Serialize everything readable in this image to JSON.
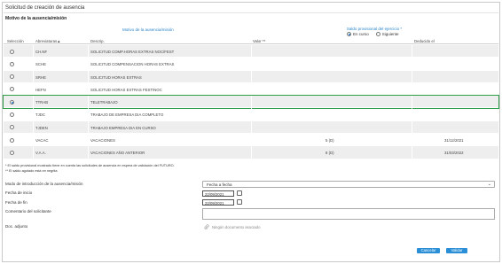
{
  "window_title": "Solicitud de creación de ausencia",
  "section_title": "Motivo de la ausencia/misión",
  "group_headers": {
    "motivo": "Motivo de la ausencia/misión",
    "saldo": "Saldo provisional del ejercicio *",
    "saldo_opt_1": "En curso",
    "saldo_opt_2": "Siguiente"
  },
  "columns": [
    "Selección",
    "Abreviaturas▲",
    "Descrip.",
    "Valor **",
    "Deducido el"
  ],
  "rows": [
    {
      "abbr": "CH.NF",
      "desc": "SOLICITUD COMP.HORAS EXTRAS NOC/FEST",
      "valor": "",
      "fecha": ""
    },
    {
      "abbr": "SCHE",
      "desc": "SOLICITUD COMPENSACION HORAS EXTRAS",
      "valor": "",
      "fecha": ""
    },
    {
      "abbr": "SRHE",
      "desc": "SOLICITUD HORAS EXTRAS",
      "valor": "",
      "fecha": ""
    },
    {
      "abbr": "HEFN",
      "desc": "SOLICITUD HORAS EXTRAS FEST/NOC",
      "valor": "",
      "fecha": ""
    },
    {
      "abbr": "TTRAB",
      "desc": "TELETRABAJO",
      "valor": "",
      "fecha": ""
    },
    {
      "abbr": "TJDC",
      "desc": "TRABAJO DE EMPRESA DIA COMPLETO",
      "valor": "",
      "fecha": ""
    },
    {
      "abbr": "TJDEN",
      "desc": "TRABAJO EMPRESA DIA EN CURSO",
      "valor": "",
      "fecha": ""
    },
    {
      "abbr": "VACAC",
      "desc": "VACACIONES",
      "valor": "5 (D)",
      "fecha": "31/12/2021"
    },
    {
      "abbr": "V.A.A.",
      "desc": "VACACIONES AÑO ANTERIOR",
      "valor": "8 (D)",
      "fecha": "31/03/2022"
    }
  ],
  "selected_row_index": 4,
  "notes": [
    "* El saldo provisional mostrado tiene en cuenta las solicitudes de ausencia en espera de validación del FUTURO.",
    "** El saldo agotado está en negrita"
  ],
  "form": {
    "modo_label": "Modo de introducción de la ausencia/misión",
    "modo_value": "Fecha a fecha",
    "inicio_label": "Fecha de inicio",
    "inicio_value": "22/09/2021",
    "fin_label": "Fecha de fin",
    "fin_value": "22/09/2021",
    "comentario_label": "Comentario del solicitante",
    "adjunto_label": "Doc. adjunto",
    "adjunto_value": "Ningún documento asociado"
  },
  "buttons": {
    "cancel": "Cancelar",
    "validate": "Validar"
  },
  "colors": {
    "accent": "#2a84c9",
    "selected_outline": "#2e9e46",
    "button": "#2a8fd6"
  }
}
